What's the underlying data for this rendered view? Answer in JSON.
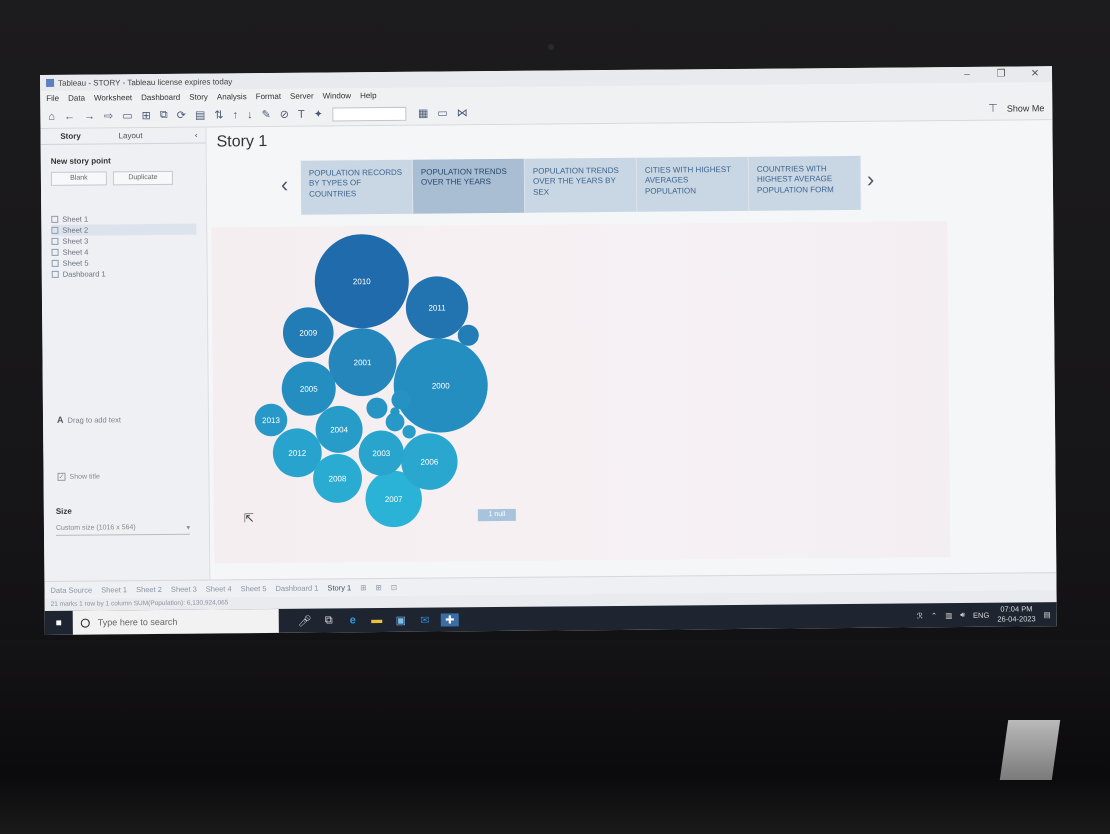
{
  "window": {
    "title": "Tableau - STORY - Tableau license expires today",
    "controls": [
      "–",
      "❐",
      "✕"
    ]
  },
  "menu": [
    "File",
    "Data",
    "Worksheet",
    "Dashboard",
    "Story",
    "Analysis",
    "Format",
    "Server",
    "Window",
    "Help"
  ],
  "toolbar": {
    "show_me": "Show Me"
  },
  "left_pane": {
    "tabs": [
      "Story",
      "Layout"
    ],
    "new_story_point": "New story point",
    "blank_button": "Blank",
    "duplicate_button": "Duplicate",
    "sheets": [
      "Sheet 1",
      "Sheet 2",
      "Sheet 3",
      "Sheet 4",
      "Sheet 5",
      "Dashboard 1"
    ],
    "drag_text": "Drag to add text",
    "show_title": "Show title",
    "size_title": "Size",
    "size_value": "Custom size (1016 x 564)"
  },
  "story": {
    "title": "Story 1",
    "points": [
      "POPULATION RECORDS BY TYPES OF COUNTRIES",
      "POPULATION TRENDS OVER THE YEARS",
      "POPULATION TRENDS OVER THE YEARS BY SEX",
      "CITIES WITH HIGHEST AVERAGES POPULATION",
      "COUNTRIES WITH HIGHEST AVERAGE POPULATION FORM"
    ],
    "null_badge": "1 null"
  },
  "chart_data": {
    "type": "packed-bubble",
    "bubbles": [
      {
        "label": "2010",
        "size": 100
      },
      {
        "label": "2000",
        "size": 100
      },
      {
        "label": "2001",
        "size": 52
      },
      {
        "label": "2011",
        "size": 44
      },
      {
        "label": "2007",
        "size": 36
      },
      {
        "label": "2006",
        "size": 36
      },
      {
        "label": "2005",
        "size": 33
      },
      {
        "label": "2009",
        "size": 29
      },
      {
        "label": "2012",
        "size": 27
      },
      {
        "label": "2008",
        "size": 27
      },
      {
        "label": "2004",
        "size": 25
      },
      {
        "label": "2003",
        "size": 23
      },
      {
        "label": "2013",
        "size": 12
      },
      {
        "label": "",
        "size": 5
      },
      {
        "label": "",
        "size": 5
      },
      {
        "label": "",
        "size": 4
      },
      {
        "label": "",
        "size": 4
      },
      {
        "label": "",
        "size": 2
      },
      {
        "label": "",
        "size": 1
      }
    ],
    "colors": {
      "dark": "#1f66a8",
      "light": "#2bb5d8"
    }
  },
  "sheet_tabs": [
    "Data Source",
    "Sheet 1",
    "Sheet 2",
    "Sheet 3",
    "Sheet 4",
    "Sheet 5",
    "Dashboard 1",
    "Story 1"
  ],
  "status_bar": "21 marks   1 row by 1 column   SUM(Population): 6,130,924,065",
  "taskbar": {
    "search_placeholder": "Type here to search",
    "language": "ENG",
    "time": "07:04 PM",
    "date": "26-04-2023"
  }
}
